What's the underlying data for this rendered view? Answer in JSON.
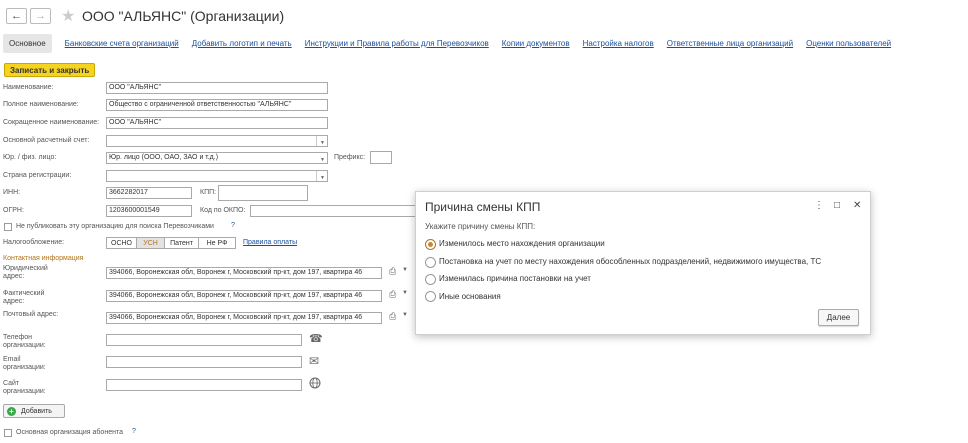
{
  "window": {
    "title": "ООО \"АЛЬЯНС\" (Организации)",
    "back_icon": "←",
    "forward_icon": "→",
    "star_icon": "★"
  },
  "tabs": [
    {
      "label": "Основное"
    },
    {
      "label": "Банковские счета организаций"
    },
    {
      "label": "Добавить логотип и печать"
    },
    {
      "label": "Инструкции и Правила работы для Перевозчиков"
    },
    {
      "label": "Копии документов"
    },
    {
      "label": "Настройка налогов"
    },
    {
      "label": "Ответственные лица организаций"
    },
    {
      "label": "Оценки пользователей"
    }
  ],
  "toolbar": {
    "save_close_label": "Записать и закрыть"
  },
  "form": {
    "name_label": "Наименование:",
    "name_value": "ООО \"АЛЬЯНС\"",
    "fullname_label": "Полное наименование:",
    "fullname_value": "Общество с ограниченной ответственностью \"АЛЬЯНС\"",
    "shortname_label": "Сокращенное наименование:",
    "shortname_value": "ООО \"АЛЬЯНС\"",
    "account_label": "Основной расчетный счет:",
    "account_value": "",
    "legal_label": "Юр. / физ. лицо:",
    "legal_value": "Юр. лицо (ООО, ОАО, ЗАО и т.д.)",
    "prefix_label": "Префикс:",
    "prefix_value": "",
    "country_label": "Страна регистрации:",
    "country_value": "",
    "inn_label": "ИНН:",
    "inn_value": "3662282017",
    "kpp_label": "КПП:",
    "kpp_value": "",
    "ogrn_label": "ОГРН:",
    "ogrn_value": "1203600001549",
    "okpo_label": "Код по ОКПО:",
    "okpo_value": "",
    "nopublish_label": "Не публиковать эту организацию для поиска Перевозчиками",
    "tax_label": "Налогообложение:",
    "tax_options": [
      "ОСНО",
      "УСН",
      "Патент",
      "Не РФ"
    ],
    "tax_selected": "УСН",
    "tax_rules_link": "Правила оплаты",
    "contact_section": "Контактная информация",
    "legal_addr_label": "Юридический адрес:",
    "legal_addr_value": "394066, Воронежская обл, Воронеж г, Московский пр-кт, дом 197, квартира 46",
    "actual_addr_label": "Фактический адрес:",
    "actual_addr_value": "394066, Воронежская обл, Воронеж г, Московский пр-кт, дом 197, квартира 46",
    "postal_addr_label": "Почтовый адрес:",
    "postal_addr_value": "394066, Воронежская обл, Воронеж г, Московский пр-кт, дом 197, квартира 46",
    "phone_label": "Телефон организации:",
    "email_label": "Email организации:",
    "site_label": "Сайт организации:",
    "add_label": "Добавить",
    "main_org_label": "Основная организация абонента",
    "help_mark": "?"
  },
  "dialog": {
    "title": "Причина смены КПП",
    "prompt": "Укажите причину смены КПП:",
    "options": [
      "Изменилось место нахождения организации",
      "Постановка на учет по месту нахождения обособленных подразделений, недвижимого имущества, ТС",
      "Изменилась причина постановки на учет",
      "Иные основания"
    ],
    "selected_index": 0,
    "next_label": "Далее",
    "more_icon": "⋮",
    "maximize_icon": "□",
    "close_icon": "✕"
  }
}
